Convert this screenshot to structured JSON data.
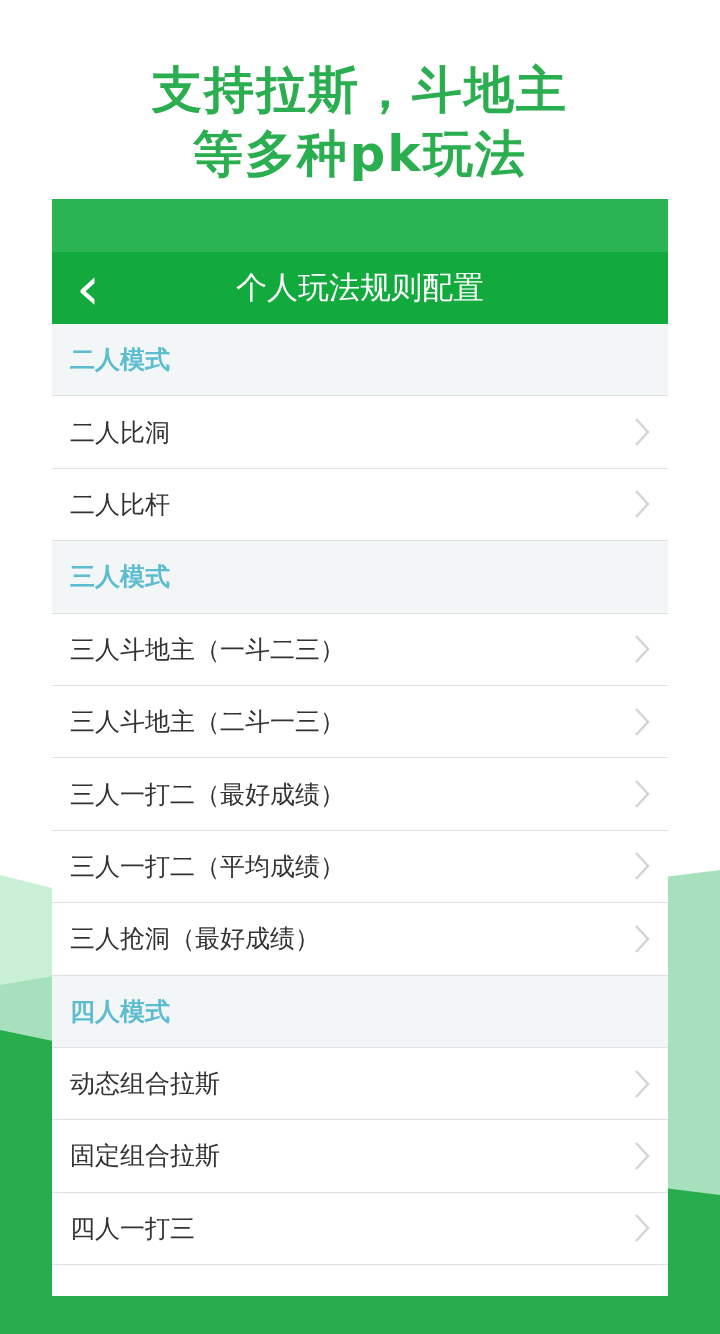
{
  "headline": [
    "支持拉斯，斗地主",
    "等多种pk玩法"
  ],
  "nav": {
    "back": "‹",
    "title": "个人玩法规则配置"
  },
  "rows": [
    {
      "kind": "header",
      "label": "二人模式"
    },
    {
      "kind": "item",
      "label": "二人比洞"
    },
    {
      "kind": "item",
      "label": "二人比杆"
    },
    {
      "kind": "header",
      "label": "三人模式"
    },
    {
      "kind": "item",
      "label": "三人斗地主（一斗二三）"
    },
    {
      "kind": "item",
      "label": "三人斗地主（二斗一三）"
    },
    {
      "kind": "item",
      "label": "三人一打二（最好成绩）"
    },
    {
      "kind": "item",
      "label": "三人一打二（平均成绩）"
    },
    {
      "kind": "item",
      "label": "三人抢洞（最好成绩）"
    },
    {
      "kind": "header",
      "label": "四人模式"
    },
    {
      "kind": "item",
      "label": "动态组合拉斯"
    },
    {
      "kind": "item",
      "label": "固定组合拉斯"
    },
    {
      "kind": "item",
      "label": "四人一打三"
    }
  ]
}
